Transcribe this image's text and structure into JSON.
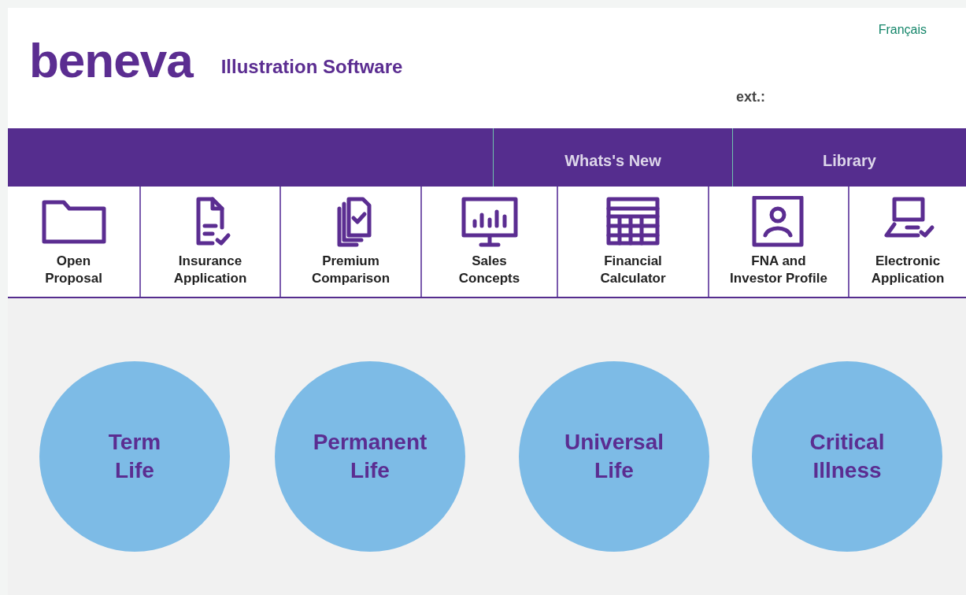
{
  "header": {
    "logo": "beneva",
    "title": "Illustration Software",
    "language_link": "Français",
    "ext_label": "ext.:"
  },
  "nav_tabs": [
    "Whats's New",
    "Library"
  ],
  "tools": [
    {
      "label": "Open\nProposal"
    },
    {
      "label": "Insurance\nApplication"
    },
    {
      "label": "Premium\nComparison"
    },
    {
      "label": "Sales\nConcepts"
    },
    {
      "label": "Financial\nCalculator"
    },
    {
      "label": "FNA and\nInvestor Profile"
    },
    {
      "label": "Electronic\nApplication"
    }
  ],
  "products": [
    {
      "label": "Term\nLife"
    },
    {
      "label": "Permanent\nLife"
    },
    {
      "label": "Universal\nLife"
    },
    {
      "label": "Critical\nIllness"
    }
  ]
}
